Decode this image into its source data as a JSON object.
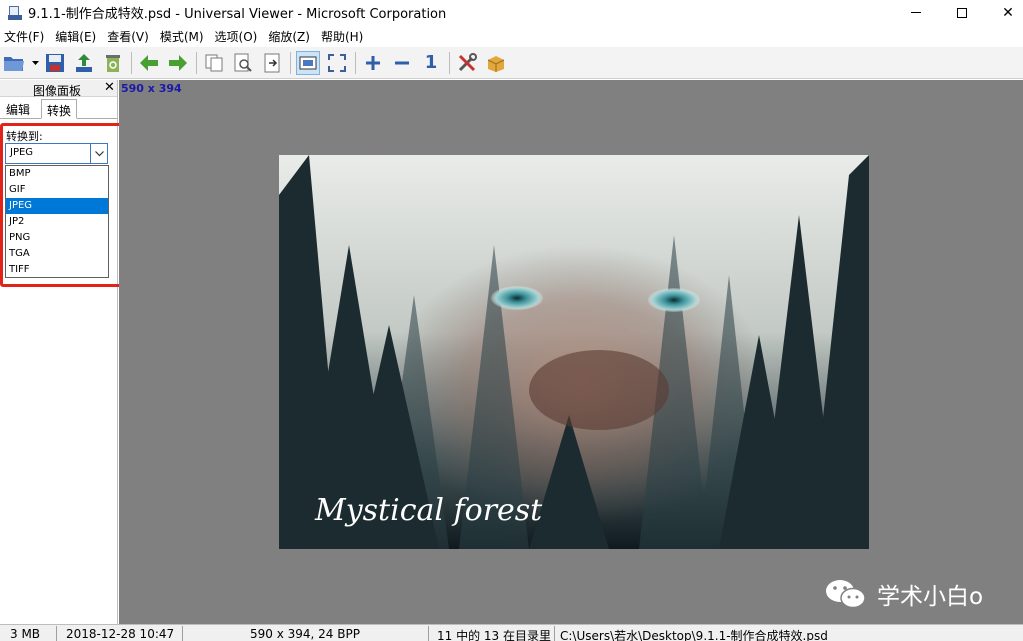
{
  "window": {
    "title": "9.1.1-制作合成特效.psd - Universal Viewer - Microsoft Corporation",
    "minimize_glyph": "—",
    "maximize_glyph": "☐",
    "close_glyph": "✕"
  },
  "menu": {
    "items": [
      "文件(F)",
      "编辑(E)",
      "查看(V)",
      "模式(M)",
      "选项(O)",
      "缩放(Z)",
      "帮助(H)"
    ]
  },
  "toolbar": {
    "icons": [
      "open-folder-icon",
      "save-icon",
      "export-icon",
      "recycle-bin-icon",
      "prev-arrow-icon",
      "next-arrow-icon",
      "copy-icon",
      "preview-icon",
      "exit-document-icon",
      "fit-window-icon",
      "fullscreen-icon",
      "zoom-in-icon",
      "zoom-out-icon",
      "actual-size-icon",
      "tools-icon",
      "package-icon"
    ],
    "actual_size_glyph": "1"
  },
  "left_panel": {
    "title": "图像面板",
    "close_glyph": "✕",
    "tabs": [
      "编辑",
      "转换"
    ],
    "active_tab": "转换",
    "convert_label": "转换到:",
    "selected_format": "JPEG",
    "format_options": [
      "BMP",
      "GIF",
      "JPEG",
      "JP2",
      "PNG",
      "TGA",
      "TIFF"
    ],
    "highlight_color": "#e2231a"
  },
  "viewer": {
    "image_size": "590 x 394",
    "image_caption": "Mystical forest",
    "background": "#808080"
  },
  "watermark": {
    "text": "学术小白o"
  },
  "status": {
    "file_size": "3 MB",
    "date": "2018-12-28 10:47",
    "dimensions": "590 x 394, 24 BPP",
    "position": "11 中的 13 在目录里",
    "path": "C:\\Users\\若水\\Desktop\\9.1.1-制作合成特效.psd"
  },
  "colors": {
    "accent": "#0078d7",
    "size_text": "#1a1aa8"
  }
}
